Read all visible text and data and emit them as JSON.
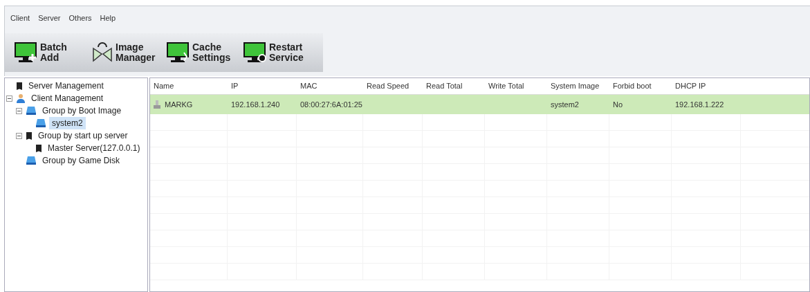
{
  "menu": [
    "Client",
    "Server",
    "Others",
    "Help"
  ],
  "toolbar": [
    {
      "label": "Batch Add",
      "kind": "add"
    },
    {
      "label": "Image Manager",
      "kind": "image"
    },
    {
      "label": "Cache Settings",
      "kind": "cache"
    },
    {
      "label": "Restart Service",
      "kind": "restart"
    }
  ],
  "tree": [
    {
      "label": "Server Management",
      "kind": "server",
      "selected": false
    },
    {
      "label": "Client Management",
      "kind": "user",
      "expanded": true,
      "selected": false,
      "children": [
        {
          "label": "Group by Boot Image",
          "kind": "disk",
          "expanded": true,
          "selected": false,
          "children": [
            {
              "label": "system2",
              "kind": "disk",
              "selected": true
            }
          ]
        },
        {
          "label": "Group by start up server",
          "kind": "server",
          "expanded": true,
          "selected": false,
          "children": [
            {
              "label": "Master Server(127.0.0.1)",
              "kind": "server",
              "selected": false
            }
          ]
        },
        {
          "label": "Group by Game Disk",
          "kind": "disk",
          "selected": false
        }
      ]
    }
  ],
  "table": {
    "columns": [
      "Name",
      "IP",
      "MAC",
      "Read Speed",
      "Read Total",
      "Write Total",
      "System Image",
      "Forbid boot",
      "DHCP IP"
    ],
    "rows": [
      {
        "selected": true,
        "cells": [
          "MARKG",
          "192.168.1.240",
          "08:00:27:6A:01:25",
          "",
          "",
          "",
          "system2",
          "No",
          "192.168.1.222"
        ]
      }
    ]
  }
}
